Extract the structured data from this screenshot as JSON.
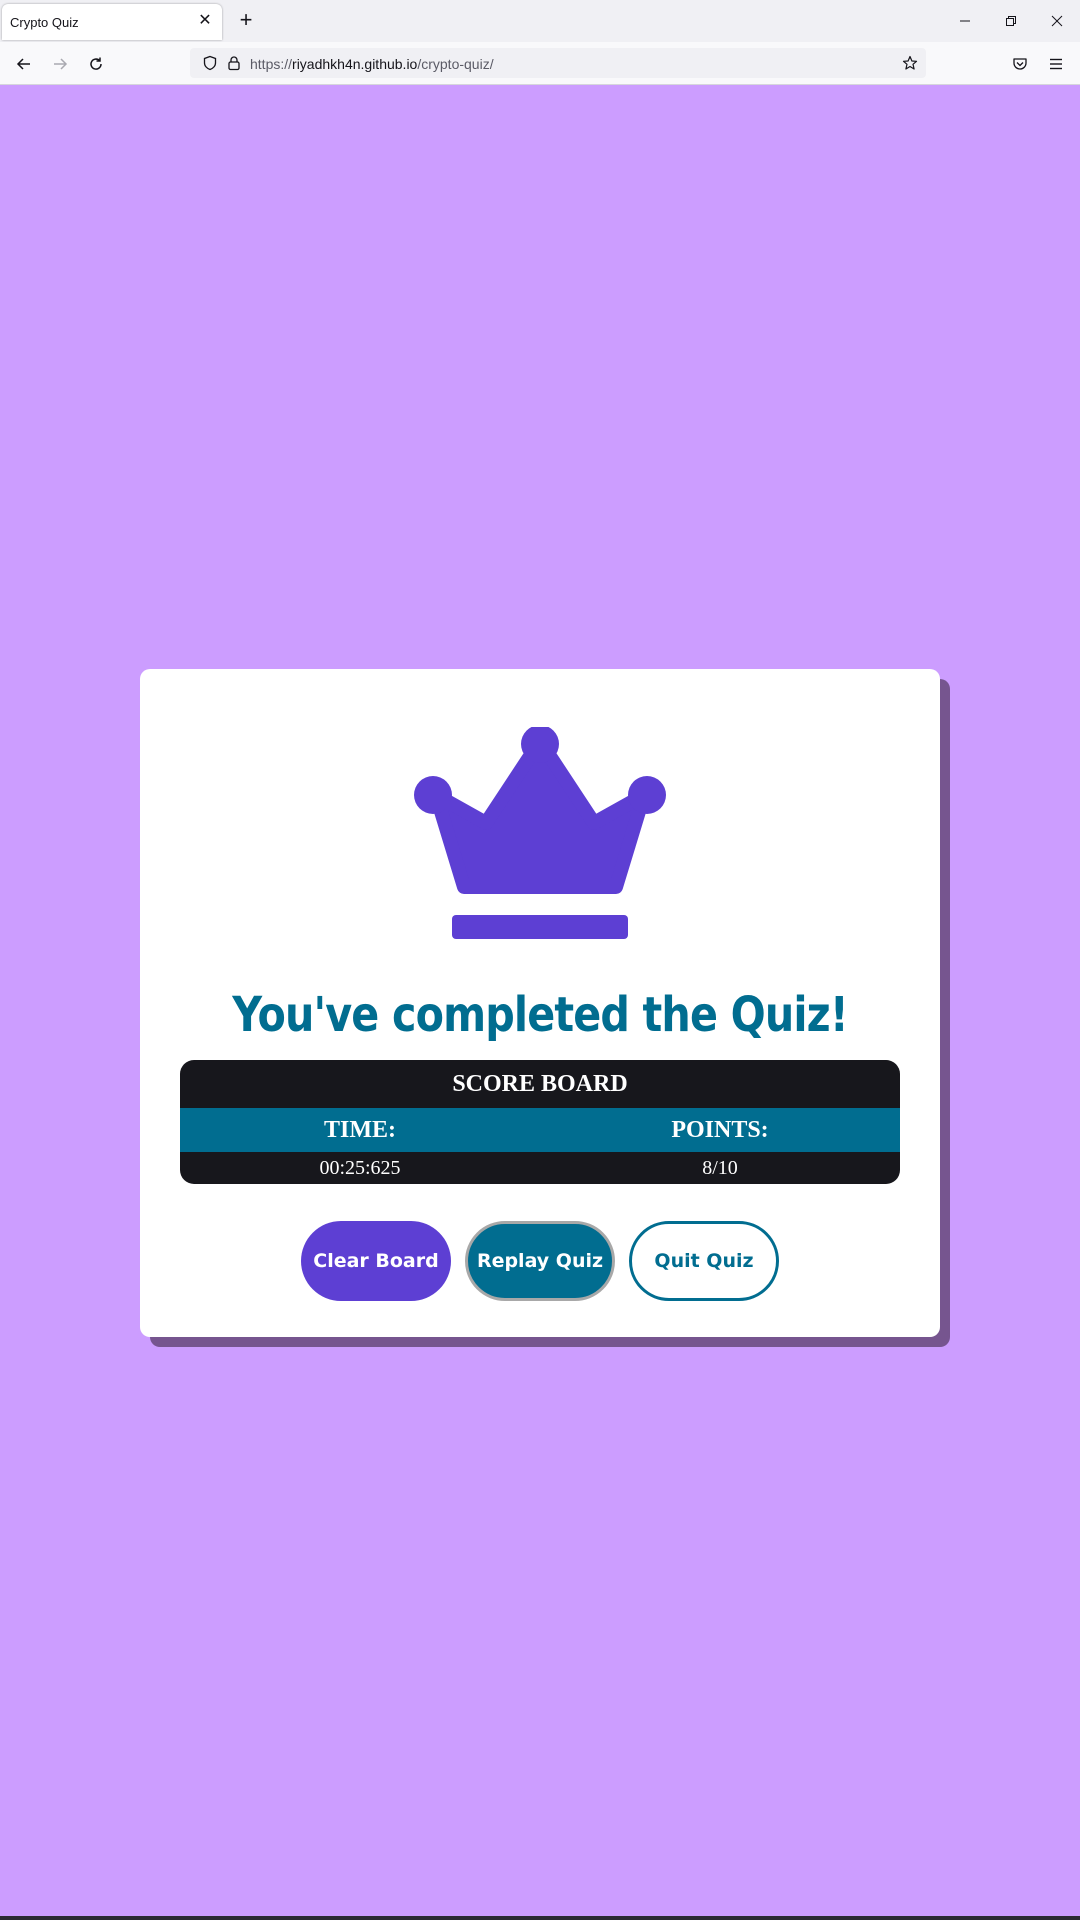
{
  "browser": {
    "tab_title": "Crypto Quiz",
    "url_prefix": "https://",
    "url_host": "riyadhkh4n.github.io",
    "url_path": "/crypto-quiz/",
    "icons": [
      "close-icon",
      "plus-icon",
      "minimize-icon",
      "restore-icon",
      "window-close-icon",
      "back-icon",
      "forward-icon",
      "reload-icon",
      "shield-icon",
      "lock-icon",
      "star-icon",
      "pocket-icon",
      "menu-icon"
    ]
  },
  "quiz": {
    "icon": "crown-icon",
    "headline": "You've completed the Quiz!",
    "scoreboard": {
      "title": "SCORE BOARD",
      "columns": [
        "TIME:",
        "POINTS:"
      ],
      "rows": [
        [
          "00:25:625",
          "8/10"
        ]
      ]
    },
    "buttons": {
      "clear": "Clear Board",
      "replay": "Replay Quiz",
      "quit": "Quit Quiz"
    }
  },
  "colors": {
    "page_background": "#cc9dff",
    "card": "#ffffff",
    "card_shadow": "#76558f",
    "accent_purple": "#5d3fd3",
    "accent_teal": "#016d90",
    "scoreboard_dark": "#17171c"
  }
}
